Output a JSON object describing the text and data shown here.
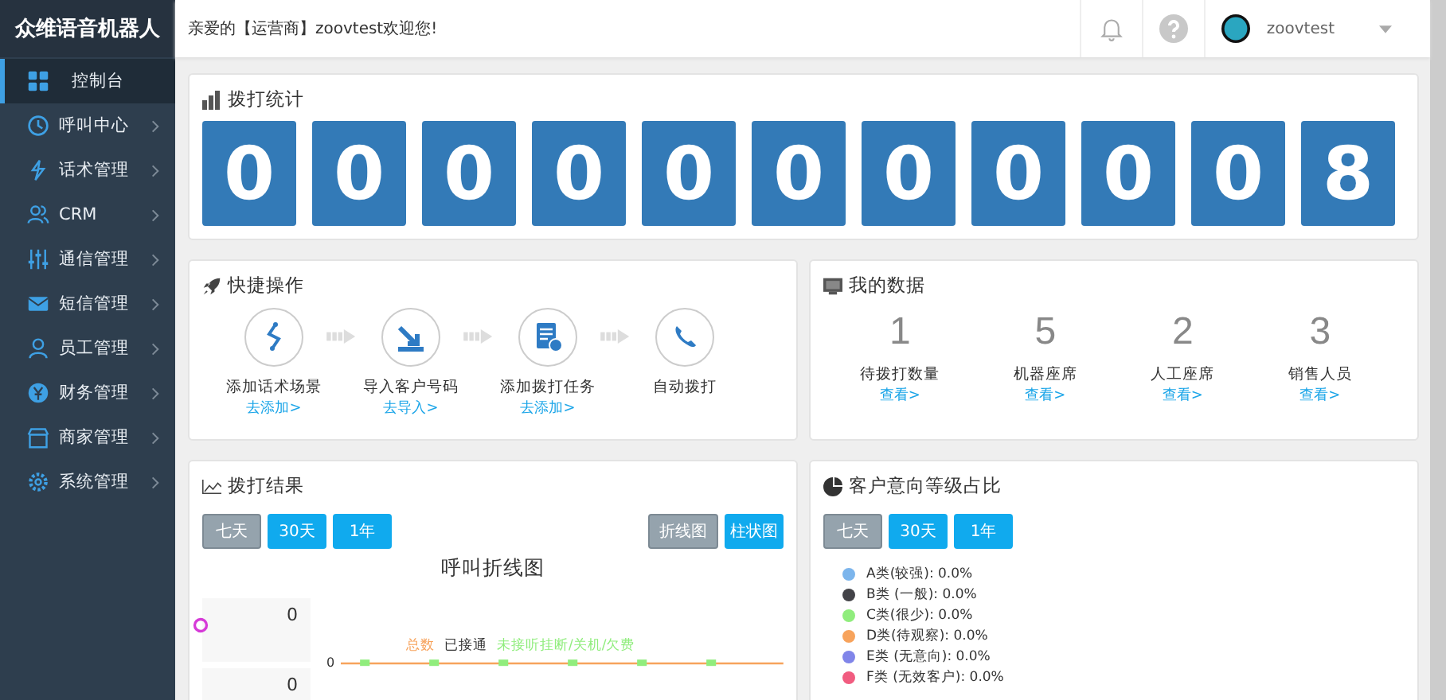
{
  "sidebar": {
    "logo": "众维语音机器人",
    "items": [
      {
        "label": "控制台",
        "selected": true,
        "expandable": false
      },
      {
        "label": "呼叫中心",
        "selected": false,
        "expandable": true
      },
      {
        "label": "话术管理",
        "selected": false,
        "expandable": true
      },
      {
        "label": "CRM",
        "selected": false,
        "expandable": true
      },
      {
        "label": "通信管理",
        "selected": false,
        "expandable": true
      },
      {
        "label": "短信管理",
        "selected": false,
        "expandable": true
      },
      {
        "label": "员工管理",
        "selected": false,
        "expandable": true
      },
      {
        "label": "财务管理",
        "selected": false,
        "expandable": true
      },
      {
        "label": "商家管理",
        "selected": false,
        "expandable": true
      },
      {
        "label": "系统管理",
        "selected": false,
        "expandable": true
      }
    ]
  },
  "header": {
    "welcome": "亲爱的【运营商】zoovtest欢迎您!",
    "username": "zoovtest"
  },
  "dial_stats": {
    "title": "拨打统计",
    "digits": [
      "0",
      "0",
      "0",
      "0",
      "0",
      "0",
      "0",
      "0",
      "0",
      "0",
      "8"
    ]
  },
  "quick_actions": {
    "title": "快捷操作",
    "steps": [
      {
        "label": "添加话术场景",
        "link": "去添加>"
      },
      {
        "label": "导入客户号码",
        "link": "去导入>"
      },
      {
        "label": "添加拨打任务",
        "link": "去添加>"
      },
      {
        "label": "自动拨打"
      }
    ]
  },
  "my_data": {
    "title": "我的数据",
    "items": [
      {
        "value": "1",
        "label": "待拨打数量",
        "link": "查看>"
      },
      {
        "value": "5",
        "label": "机器座席",
        "link": "查看>"
      },
      {
        "value": "2",
        "label": "人工座席",
        "link": "查看>"
      },
      {
        "value": "3",
        "label": "销售人员",
        "link": "查看>"
      }
    ]
  },
  "dial_results": {
    "title": "拨打结果",
    "ranges": [
      {
        "label": "七天",
        "selected": true
      },
      {
        "label": "30天",
        "selected": false
      },
      {
        "label": "1年",
        "selected": false
      }
    ],
    "chart_types": [
      {
        "label": "折线图",
        "selected": true
      },
      {
        "label": "柱状图",
        "selected": false
      }
    ],
    "chart_title": "呼叫折线图",
    "total": "0",
    "next_total": "0",
    "axis_tick": "0",
    "legend": [
      {
        "label": "总数",
        "color": "#f7a35c"
      },
      {
        "label": "已接通",
        "color": "#333333"
      },
      {
        "label": "未接听挂断/关机/欠费",
        "color": "#90ed7d"
      }
    ]
  },
  "intent_levels": {
    "title": "客户意向等级占比",
    "ranges": [
      {
        "label": "七天",
        "selected": true
      },
      {
        "label": "30天",
        "selected": false
      },
      {
        "label": "1年",
        "selected": false
      }
    ],
    "legend": [
      {
        "label": "A类(较强): 0.0%",
        "color": "#7cb5ec"
      },
      {
        "label": "B类 (一般): 0.0%",
        "color": "#434348"
      },
      {
        "label": "C类(很少): 0.0%",
        "color": "#90ed7d"
      },
      {
        "label": "D类(待观察): 0.0%",
        "color": "#f7a35c"
      },
      {
        "label": "E类 (无意向): 0.0%",
        "color": "#8085e9"
      },
      {
        "label": "F类 (无效客户): 0.0%",
        "color": "#f15c80"
      }
    ]
  }
}
